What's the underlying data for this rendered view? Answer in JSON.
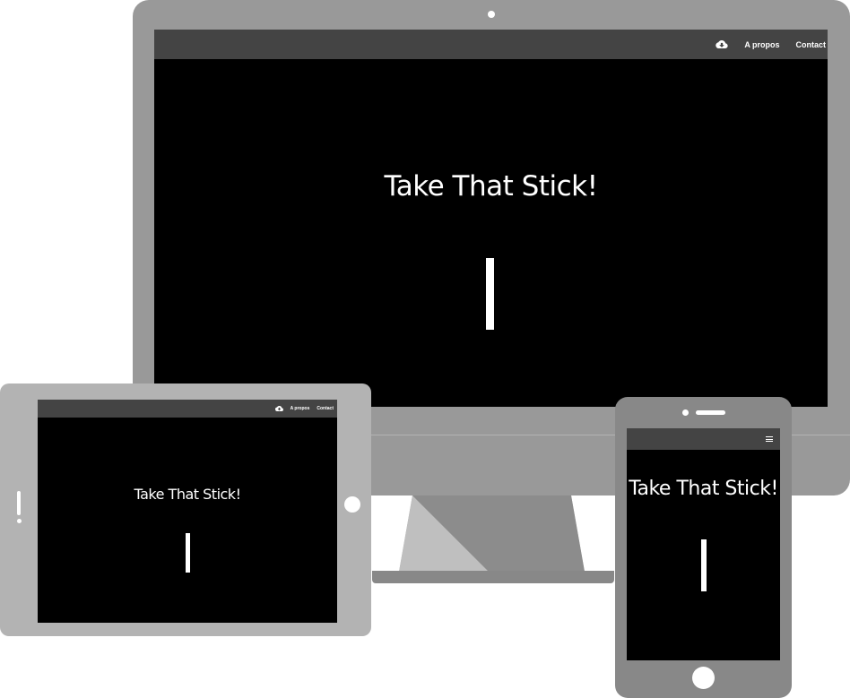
{
  "colors": {
    "frame_desktop": "#999999",
    "frame_tablet": "#b3b3b3",
    "frame_phone": "#888888",
    "screen_background": "#000000",
    "navbar_background": "#444444",
    "text": "#ffffff"
  },
  "desktop": {
    "nav": {
      "icon": "cloud-download-icon",
      "links": [
        "A propos",
        "Contact"
      ]
    },
    "title": "Take That Stick!"
  },
  "tablet": {
    "nav": {
      "icon": "cloud-download-icon",
      "links": [
        "A propos",
        "Contact"
      ]
    },
    "title": "Take That Stick!"
  },
  "phone": {
    "nav": {
      "icon": "hamburger-menu-icon"
    },
    "title": "Take That Stick!"
  }
}
